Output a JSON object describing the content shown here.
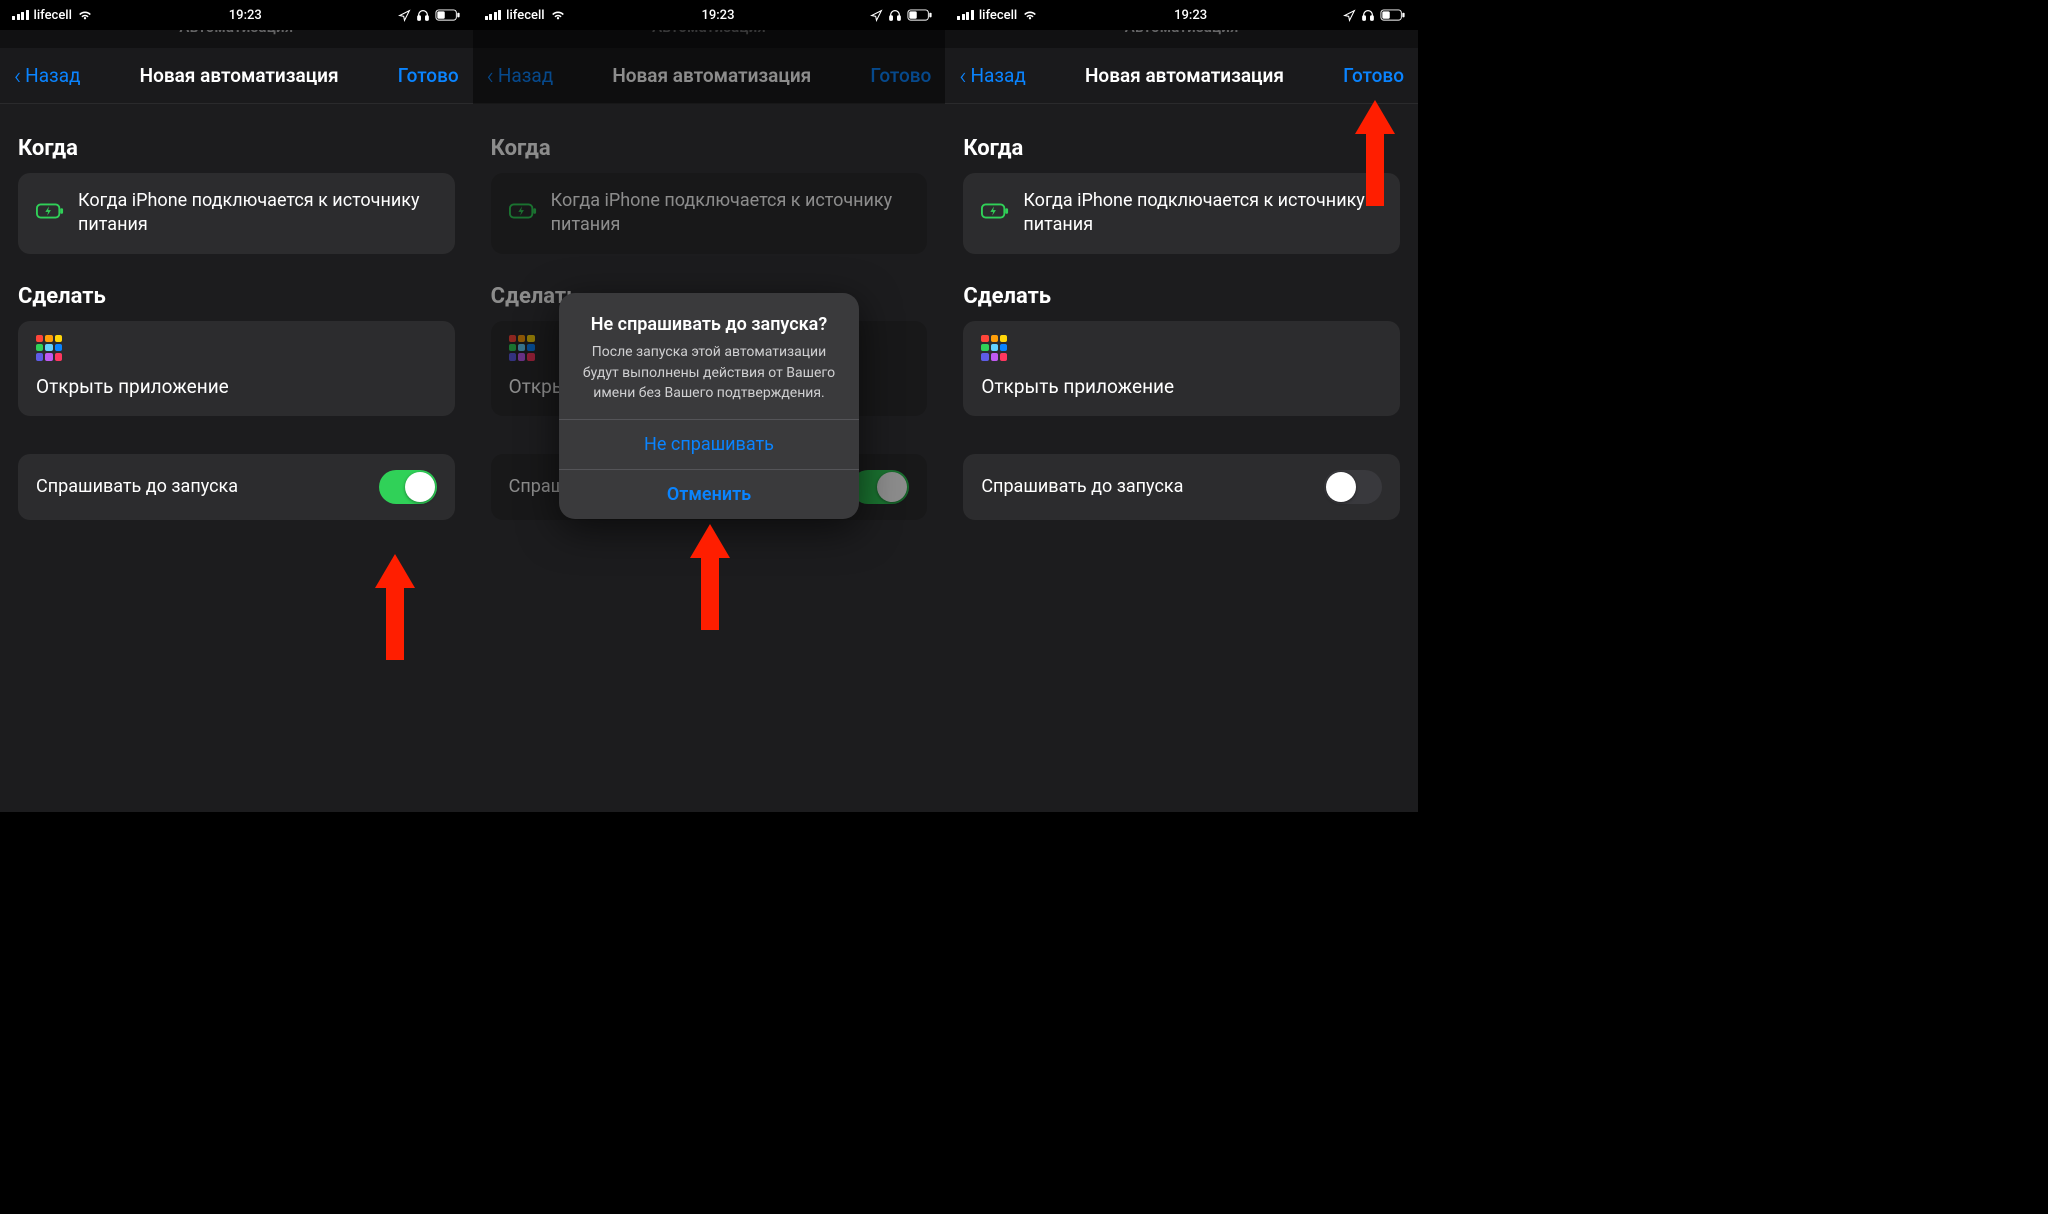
{
  "status": {
    "carrier": "lifecell",
    "time": "19:23"
  },
  "peek_title": "Автоматизация",
  "nav": {
    "back": "Назад",
    "title": "Новая автоматизация",
    "done": "Готово"
  },
  "sections": {
    "when_title": "Когда",
    "when_text": "Когда iPhone подключается к источнику питания",
    "do_title": "Сделать",
    "do_text": "Открыть приложение",
    "ask_label": "Спрашивать до запуска"
  },
  "app_grid_colors": [
    "#ff453a",
    "#ff9f0a",
    "#ffd60a",
    "#30d158",
    "#64d2ff",
    "#0a84ff",
    "#5e5ce6",
    "#bf5af2",
    "#ff375f"
  ],
  "alert": {
    "title": "Не спрашивать до запуска?",
    "message": "После запуска этой автоматизации будут выполнены действия от Вашего имени без Вашего подтверждения.",
    "confirm": "Не спрашивать",
    "cancel": "Отменить"
  },
  "screens": [
    {
      "toggle_on": true,
      "show_alert": false,
      "arrow_target": "toggle"
    },
    {
      "toggle_on": true,
      "show_alert": true,
      "arrow_target": "alert-confirm"
    },
    {
      "toggle_on": false,
      "show_alert": false,
      "arrow_target": "done"
    }
  ]
}
